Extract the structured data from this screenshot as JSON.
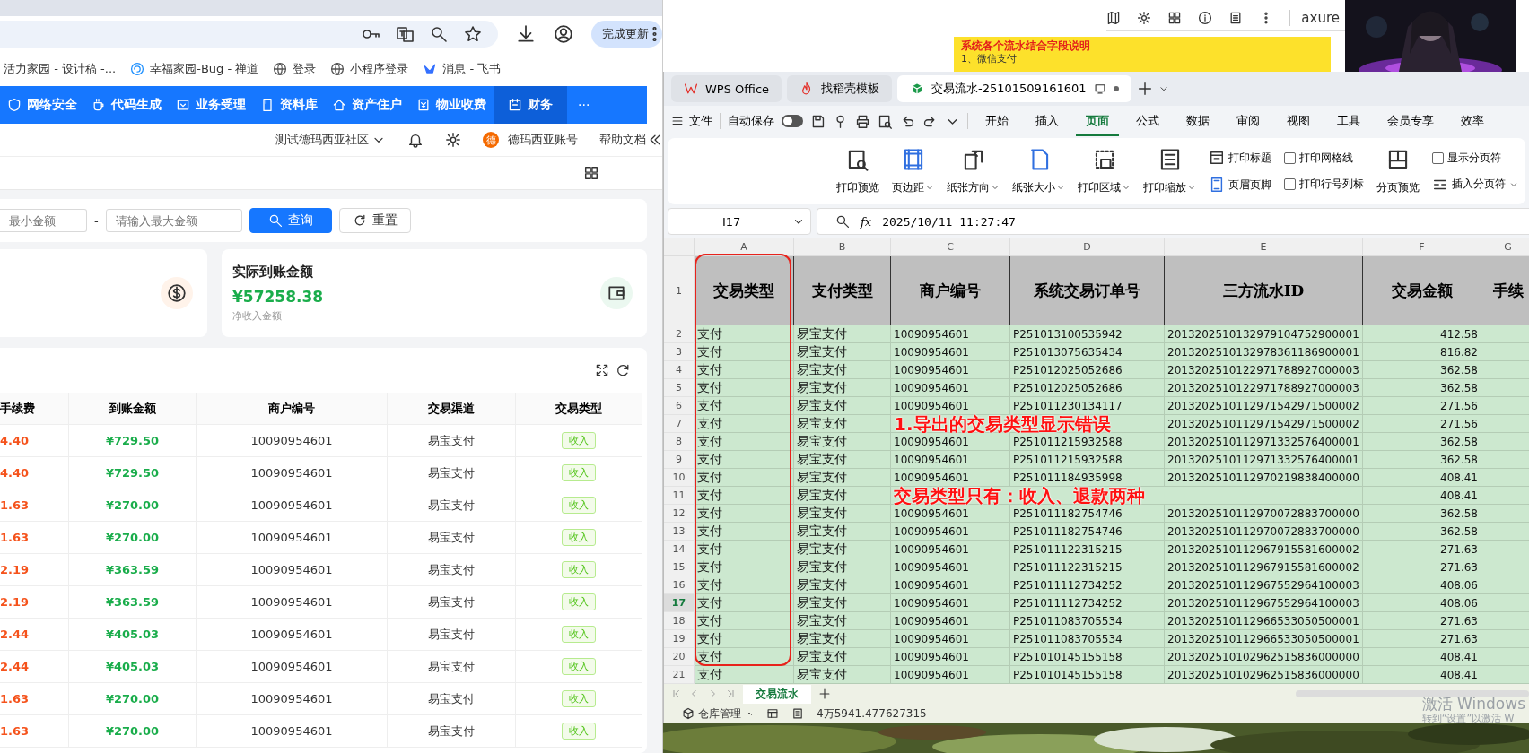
{
  "browser": {
    "update_button": "完成更新",
    "bookmarks": [
      {
        "label": "活力家园 - 设计稿 -..."
      },
      {
        "label": "幸福家园-Bug - 禅道"
      },
      {
        "label": "登录"
      },
      {
        "label": "小程序登录"
      },
      {
        "label": "消息 - 飞书"
      }
    ],
    "nav": [
      {
        "label": "网络安全",
        "selected": false
      },
      {
        "label": "代码生成",
        "selected": false
      },
      {
        "label": "业务受理",
        "selected": false
      },
      {
        "label": "资料库",
        "selected": false
      },
      {
        "label": "资产住户",
        "selected": false
      },
      {
        "label": "物业收费",
        "selected": false
      },
      {
        "label": "财务",
        "selected": true
      }
    ],
    "nav_more": "···",
    "header": {
      "community": "测试德玛西亚社区",
      "avatar": "德",
      "account": "德玛西亚账号",
      "help": "帮助文档"
    },
    "filters": {
      "min_placeholder": "最小金额",
      "separator": "-",
      "max_placeholder": "请输入最大金额",
      "search": "查询",
      "reset": "重置"
    },
    "stats": [
      {
        "kind": "icon_only"
      },
      {
        "kind": "full",
        "title": "实际到账金额",
        "value": "¥57258.38",
        "caption": "净收入金额"
      }
    ],
    "table": {
      "columns": [
        "手续费",
        "到账金额",
        "商户编号",
        "交易渠道",
        "交易类型"
      ],
      "rows": [
        [
          "4.40",
          "¥729.50",
          "10090954601",
          "易宝支付",
          "收入"
        ],
        [
          "4.40",
          "¥729.50",
          "10090954601",
          "易宝支付",
          "收入"
        ],
        [
          "1.63",
          "¥270.00",
          "10090954601",
          "易宝支付",
          "收入"
        ],
        [
          "1.63",
          "¥270.00",
          "10090954601",
          "易宝支付",
          "收入"
        ],
        [
          "2.19",
          "¥363.59",
          "10090954601",
          "易宝支付",
          "收入"
        ],
        [
          "2.19",
          "¥363.59",
          "10090954601",
          "易宝支付",
          "收入"
        ],
        [
          "2.44",
          "¥405.03",
          "10090954601",
          "易宝支付",
          "收入"
        ],
        [
          "2.44",
          "¥405.03",
          "10090954601",
          "易宝支付",
          "收入"
        ],
        [
          "1.63",
          "¥270.00",
          "10090954601",
          "易宝支付",
          "收入"
        ],
        [
          "1.63",
          "¥270.00",
          "10090954601",
          "易宝支付",
          "收入"
        ]
      ]
    }
  },
  "axure": {
    "brand": "axure",
    "note_title": "系统各个流水结合字段说明",
    "note_line": "1、微信支付"
  },
  "wps": {
    "tabs": [
      {
        "label": "WPS Office",
        "kind": "home",
        "selected": false
      },
      {
        "label": "找稻壳模板",
        "kind": "template",
        "selected": false
      },
      {
        "label": "交易流水-25101509161601",
        "kind": "sheet",
        "selected": true
      }
    ],
    "file_menu": "文件",
    "autosave": {
      "label": "自动保存",
      "on": false
    },
    "menu_tabs": [
      {
        "label": "开始",
        "selected": false
      },
      {
        "label": "插入",
        "selected": false
      },
      {
        "label": "页面",
        "selected": true
      },
      {
        "label": "公式",
        "selected": false
      },
      {
        "label": "数据",
        "selected": false
      },
      {
        "label": "审阅",
        "selected": false
      },
      {
        "label": "视图",
        "selected": false
      },
      {
        "label": "工具",
        "selected": false
      },
      {
        "label": "会员专享",
        "selected": false
      },
      {
        "label": "效率",
        "selected": false
      }
    ],
    "ribbon": [
      {
        "kind": "large",
        "label": "打印预览",
        "dropdown": false
      },
      {
        "kind": "large",
        "label": "页边距",
        "dropdown": true
      },
      {
        "kind": "large",
        "label": "纸张方向",
        "dropdown": true
      },
      {
        "kind": "large",
        "label": "纸张大小",
        "dropdown": true
      },
      {
        "kind": "large",
        "label": "打印区域",
        "dropdown": true
      },
      {
        "kind": "large",
        "label": "打印缩放",
        "dropdown": true
      },
      {
        "kind": "pair",
        "items": [
          {
            "kind": "small",
            "label": "打印标题",
            "dropdown": false
          },
          {
            "kind": "small",
            "label": "页眉页脚",
            "dropdown": false
          }
        ]
      },
      {
        "kind": "pair",
        "items": [
          {
            "kind": "check",
            "label": "打印网格线",
            "checked": false
          },
          {
            "kind": "check",
            "label": "打印行号列标",
            "checked": false
          }
        ]
      },
      {
        "kind": "large",
        "label": "分页预览",
        "dropdown": false
      },
      {
        "kind": "pair",
        "items": [
          {
            "kind": "check",
            "label": "显示分页符",
            "checked": false
          },
          {
            "kind": "small",
            "label": "插入分页符",
            "dropdown": true
          }
        ]
      }
    ],
    "name_box": "I17",
    "function_label": "fx",
    "formula": "2025/10/11 11:27:47",
    "column_letters": [
      "A",
      "B",
      "C",
      "D",
      "E",
      "F",
      "G"
    ],
    "header_row": {
      "row_number": "1",
      "cells": [
        "交易类型",
        "支付类型",
        "商户编号",
        "系统交易订单号",
        "三方流水ID",
        "交易金额",
        "手续"
      ]
    },
    "rows": [
      {
        "row_number": "2",
        "selected": false,
        "cells": [
          "支付",
          "易宝支付",
          "10090954601",
          "P251013100535942",
          "2013202510132979104752900001",
          "412.58"
        ]
      },
      {
        "row_number": "3",
        "selected": false,
        "cells": [
          "支付",
          "易宝支付",
          "10090954601",
          "P251013075635434",
          "2013202510132978361186900001",
          "816.82"
        ]
      },
      {
        "row_number": "4",
        "selected": false,
        "cells": [
          "支付",
          "易宝支付",
          "10090954601",
          "P251012025052686",
          "2013202510122971788927000003",
          "362.58"
        ]
      },
      {
        "row_number": "5",
        "selected": false,
        "cells": [
          "支付",
          "易宝支付",
          "10090954601",
          "P251012025052686",
          "2013202510122971788927000003",
          "362.58"
        ]
      },
      {
        "row_number": "6",
        "selected": false,
        "cells": [
          "支付",
          "易宝支付",
          "10090954601",
          "P251011230134117",
          "2013202510112971542971500002",
          "271.56"
        ]
      },
      {
        "row_number": "7",
        "selected": false,
        "cells": [
          "支付",
          "易宝支付",
          null,
          null,
          "2013202510112971542971500002",
          "271.56"
        ]
      },
      {
        "row_number": "8",
        "selected": false,
        "cells": [
          "支付",
          "易宝支付",
          "10090954601",
          "P251011215932588",
          "2013202510112971332576400001",
          "362.58"
        ]
      },
      {
        "row_number": "9",
        "selected": false,
        "cells": [
          "支付",
          "易宝支付",
          "10090954601",
          "P251011215932588",
          "2013202510112971332576400001",
          "362.58"
        ]
      },
      {
        "row_number": "10",
        "selected": false,
        "cells": [
          "支付",
          "易宝支付",
          "10090954601",
          "P251011184935998",
          "2013202510112970219838400000",
          "408.41"
        ]
      },
      {
        "row_number": "11",
        "selected": false,
        "cells": [
          "支付",
          "易宝支付",
          null,
          null,
          null,
          "408.41"
        ]
      },
      {
        "row_number": "12",
        "selected": false,
        "cells": [
          "支付",
          "易宝支付",
          "10090954601",
          "P251011182754746",
          "2013202510112970072883700000",
          "362.58"
        ]
      },
      {
        "row_number": "13",
        "selected": false,
        "cells": [
          "支付",
          "易宝支付",
          "10090954601",
          "P251011182754746",
          "2013202510112970072883700000",
          "362.58"
        ]
      },
      {
        "row_number": "14",
        "selected": false,
        "cells": [
          "支付",
          "易宝支付",
          "10090954601",
          "P251011122315215",
          "2013202510112967915581600002",
          "271.63"
        ]
      },
      {
        "row_number": "15",
        "selected": false,
        "cells": [
          "支付",
          "易宝支付",
          "10090954601",
          "P251011122315215",
          "2013202510112967915581600002",
          "271.63"
        ]
      },
      {
        "row_number": "16",
        "selected": false,
        "cells": [
          "支付",
          "易宝支付",
          "10090954601",
          "P251011112734252",
          "2013202510112967552964100003",
          "408.06"
        ]
      },
      {
        "row_number": "17",
        "selected": true,
        "cells": [
          "支付",
          "易宝支付",
          "10090954601",
          "P251011112734252",
          "2013202510112967552964100003",
          "408.06"
        ]
      },
      {
        "row_number": "18",
        "selected": false,
        "cells": [
          "支付",
          "易宝支付",
          "10090954601",
          "P251011083705534",
          "2013202510112966533050500001",
          "271.63"
        ]
      },
      {
        "row_number": "19",
        "selected": false,
        "cells": [
          "支付",
          "易宝支付",
          "10090954601",
          "P251011083705534",
          "2013202510112966533050500001",
          "271.63"
        ]
      },
      {
        "row_number": "20",
        "selected": false,
        "cells": [
          "支付",
          "易宝支付",
          "10090954601",
          "P251010145155158",
          "2013202510102962515836000000",
          "408.41"
        ]
      },
      {
        "row_number": "21",
        "selected": false,
        "cells": [
          "支付",
          "易宝支付",
          "10090954601",
          "P251010145155158",
          "2013202510102962515836000000",
          "408.41"
        ]
      }
    ],
    "annotations": [
      "1.导出的交易类型显示错误",
      "交易类型只有：收入、退款两种"
    ],
    "sheet_tabs": [
      {
        "label": "交易流水",
        "selected": true
      }
    ],
    "status": {
      "workspace": "仓库管理",
      "sum": "4万5941.477627315"
    },
    "activation": {
      "title": "激活 Windows",
      "hint": "转到“设置”以激活 W"
    }
  }
}
